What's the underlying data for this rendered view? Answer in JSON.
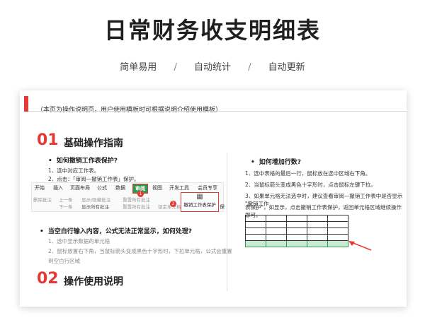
{
  "header": {
    "title": "日常财务收支明细表",
    "features": [
      "简单易用",
      "自动统计",
      "自动更新"
    ],
    "separator": "/"
  },
  "card": {
    "note": "（本页为操作说明页，用户使用模板时可根据说明介绍使用模板）",
    "section1": {
      "num": "01",
      "title": "基础操作指南",
      "q1": {
        "heading": "如何撤销工作表保护?",
        "steps": [
          "1、选中对应工作表。",
          "2、点击：「审阅—撤销工作表」保护。"
        ]
      },
      "ribbon": {
        "tabs": [
          "开始",
          "插入",
          "页面布局",
          "公式",
          "数据",
          "审阅",
          "视图",
          "开发工具",
          "会员专享"
        ],
        "active_tab": "审阅",
        "tools": [
          "删除批注",
          "上一条",
          "下一条",
          "显示/隐藏批注",
          "显示所有批注",
          "重置所有批注",
          "重置所有批注",
          "锁定单元格"
        ],
        "protect_label": "撤销工作表保护",
        "protect_extra": "保",
        "badge1": "1",
        "badge2": "2"
      },
      "q2": {
        "heading": "当空白行输入内容，公式无法正常显示，如何处理?",
        "steps": [
          "1、选中显示数据的单元格",
          "2、鼠标放置右下角，当鼠标箭头变成黑色十字形时，下拉单元格，公式会重置",
          "到空白行区域"
        ]
      }
    },
    "right": {
      "heading": "如何增加行数?",
      "steps": [
        "1、选中表格的最后一行，鼠标放在选中区域右下角。",
        "2、当鼠标箭头变成黑色十字形时，点击鼠标左键下拉。",
        "3、如果单元格无法选中时，建议查看审阅—撤销工作表中是否显示 \"撤销工作",
        "表保护\"，如显示，点击撤销工作表保护，返回单元格区域继续操作即可。"
      ],
      "grid_rows": 5,
      "grid_cols": 5
    },
    "section2": {
      "num": "02",
      "title": "操作使用说明"
    }
  },
  "colors": {
    "accent_red": "#e53935",
    "accent_green": "#2e9a4e"
  }
}
